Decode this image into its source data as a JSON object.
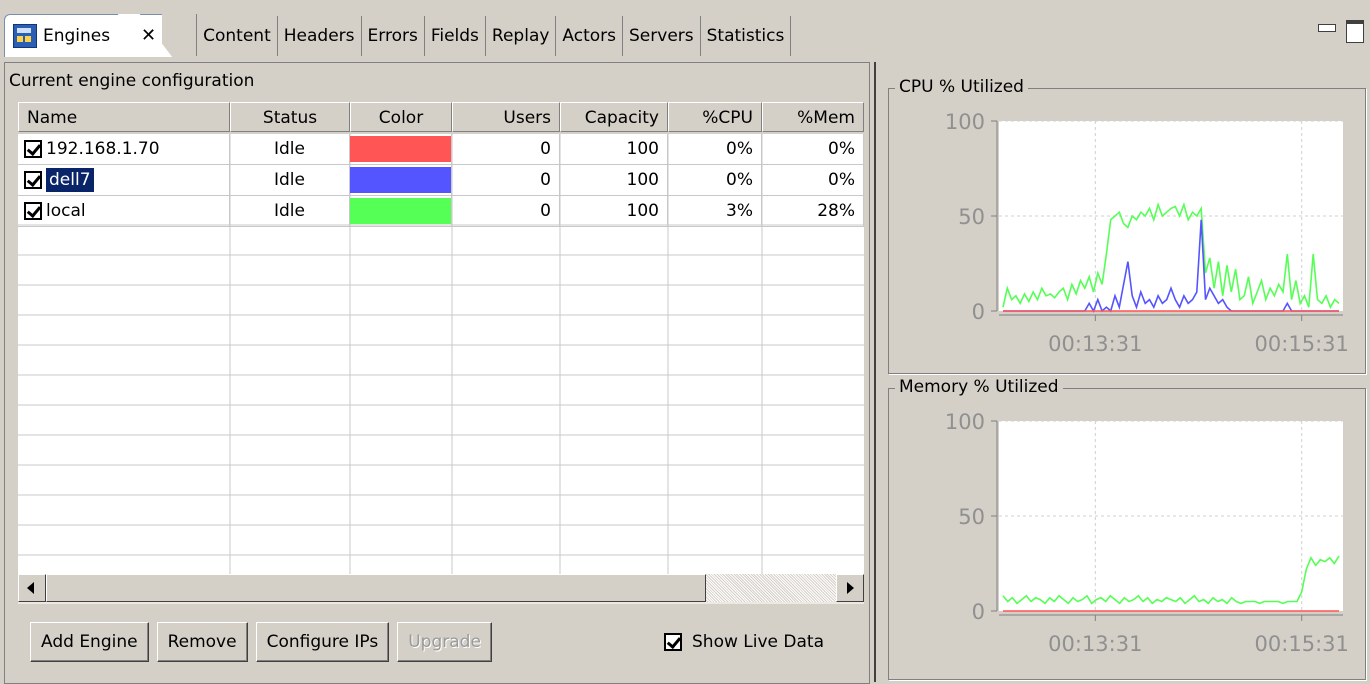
{
  "tabs": {
    "active": "Engines",
    "others": [
      "Content",
      "Headers",
      "Errors",
      "Fields",
      "Replay",
      "Actors",
      "Servers",
      "Statistics"
    ]
  },
  "left": {
    "config_label": "Current engine configuration",
    "columns": [
      "Name",
      "Status",
      "Color",
      "Users",
      "Capacity",
      "%CPU",
      "%Mem"
    ],
    "rows": [
      {
        "name": "192.168.1.70",
        "status": "Idle",
        "color": "#ff5555",
        "users": "0",
        "capacity": "100",
        "cpu": "0%",
        "mem": "0%",
        "checked": true,
        "selected": false
      },
      {
        "name": "dell7",
        "status": "Idle",
        "color": "#5555ff",
        "users": "0",
        "capacity": "100",
        "cpu": "0%",
        "mem": "0%",
        "checked": true,
        "selected": true
      },
      {
        "name": "local",
        "status": "Idle",
        "color": "#55ff55",
        "users": "0",
        "capacity": "100",
        "cpu": "3%",
        "mem": "28%",
        "checked": true,
        "selected": false
      }
    ],
    "buttons": {
      "add": "Add Engine",
      "remove": "Remove",
      "configure": "Configure IPs",
      "upgrade": "Upgrade"
    },
    "show_live_data": "Show Live Data"
  },
  "chart_data": [
    {
      "type": "line",
      "title": "CPU % Utilized",
      "ylim": [
        0,
        100
      ],
      "yticks": [
        "0",
        "50",
        "100"
      ],
      "xticks": [
        "00:13:31",
        "00:15:31"
      ],
      "series": [
        {
          "color": "#55ff55",
          "values": [
            2,
            12,
            6,
            8,
            4,
            9,
            5,
            10,
            6,
            12,
            8,
            9,
            7,
            10,
            12,
            6,
            14,
            9,
            16,
            12,
            18,
            10,
            20,
            14,
            30,
            48,
            50,
            52,
            46,
            44,
            50,
            48,
            52,
            50,
            54,
            48,
            56,
            50,
            52,
            54,
            55,
            50,
            56,
            48,
            52,
            50,
            54,
            20,
            28,
            12,
            26,
            8,
            24,
            10,
            22,
            6,
            8,
            18,
            4,
            10,
            16,
            6,
            12,
            8,
            14,
            10,
            30,
            6,
            16,
            4,
            8,
            2,
            30,
            6,
            4,
            8,
            2,
            6,
            4
          ]
        },
        {
          "color": "#5555ff",
          "values": [
            0,
            0,
            0,
            0,
            0,
            0,
            0,
            0,
            0,
            0,
            0,
            0,
            0,
            0,
            0,
            0,
            0,
            0,
            0,
            0,
            4,
            0,
            6,
            0,
            2,
            0,
            8,
            2,
            14,
            26,
            8,
            2,
            10,
            4,
            6,
            2,
            8,
            4,
            6,
            12,
            6,
            2,
            8,
            4,
            6,
            10,
            48,
            6,
            12,
            8,
            4,
            6,
            2,
            0,
            0,
            0,
            0,
            0,
            0,
            0,
            0,
            0,
            0,
            0,
            0,
            0,
            4,
            0,
            0,
            0,
            0,
            0,
            0,
            0,
            0,
            0,
            0,
            0,
            0
          ]
        },
        {
          "color": "#ff5555",
          "values": [
            0,
            0,
            0,
            0,
            0,
            0,
            0,
            0,
            0,
            0,
            0,
            0,
            0,
            0,
            0,
            0,
            0,
            0,
            0,
            0,
            0,
            0,
            0,
            0,
            0,
            0,
            0,
            0,
            0,
            0,
            0,
            0,
            0,
            0,
            0,
            0,
            0,
            0,
            0,
            0,
            0,
            0,
            0,
            0,
            0,
            0,
            0,
            0,
            0,
            0,
            0,
            0,
            0,
            0,
            0,
            0,
            0,
            0,
            0,
            0,
            0,
            0,
            0,
            0,
            0,
            0,
            0,
            0,
            0,
            0,
            0,
            0,
            0,
            0,
            0,
            0,
            0,
            0,
            0
          ]
        }
      ]
    },
    {
      "type": "line",
      "title": "Memory % Utilized",
      "ylim": [
        0,
        100
      ],
      "yticks": [
        "0",
        "50",
        "100"
      ],
      "xticks": [
        "00:13:31",
        "00:15:31"
      ],
      "series": [
        {
          "color": "#55ff55",
          "values": [
            8,
            5,
            7,
            4,
            6,
            8,
            5,
            7,
            6,
            4,
            7,
            5,
            8,
            6,
            4,
            7,
            5,
            6,
            8,
            4,
            6,
            7,
            5,
            8,
            6,
            4,
            7,
            5,
            6,
            8,
            5,
            7,
            4,
            6,
            5,
            7,
            6,
            5,
            7,
            4,
            6,
            8,
            5,
            6,
            4,
            7,
            5,
            6,
            4,
            7,
            5,
            4,
            5,
            5,
            5,
            4,
            5,
            5,
            5,
            5,
            4,
            5,
            5,
            5,
            10,
            22,
            28,
            24,
            27,
            26,
            28,
            25,
            29
          ]
        },
        {
          "color": "#ff5555",
          "values": [
            0,
            0,
            0,
            0,
            0,
            0,
            0,
            0,
            0,
            0,
            0,
            0,
            0,
            0,
            0,
            0,
            0,
            0,
            0,
            0,
            0,
            0,
            0,
            0,
            0,
            0,
            0,
            0,
            0,
            0,
            0,
            0,
            0,
            0,
            0,
            0,
            0,
            0,
            0,
            0,
            0,
            0,
            0,
            0,
            0,
            0,
            0,
            0,
            0,
            0,
            0,
            0,
            0,
            0,
            0,
            0,
            0,
            0,
            0,
            0,
            0,
            0,
            0,
            0,
            0,
            0,
            0,
            0,
            0,
            0,
            0,
            0,
            0
          ]
        }
      ]
    }
  ]
}
